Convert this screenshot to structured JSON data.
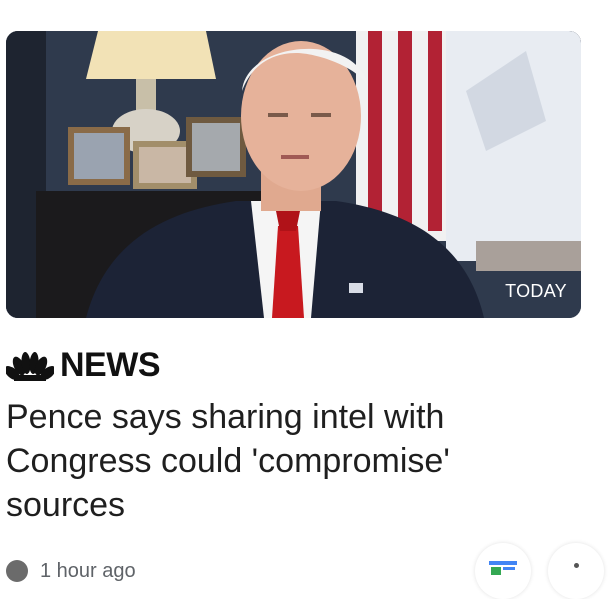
{
  "article": {
    "video_badge": "TODAY",
    "source_name": "NEWS",
    "source_logo_icon": "nbc-peacock-icon",
    "headline": "Pence says sharing intel with Congress could 'compromise' sources",
    "time_ago": "1 hour ago"
  },
  "actions": {
    "full_coverage_icon": "full-coverage-icon",
    "more_icon": "more-vert-icon"
  },
  "colors": {
    "nbc_peacock": [
      "#e6a117",
      "#e5492d",
      "#a6236c",
      "#2c7bc1",
      "#1f9e4a",
      "#6a3c97"
    ]
  }
}
